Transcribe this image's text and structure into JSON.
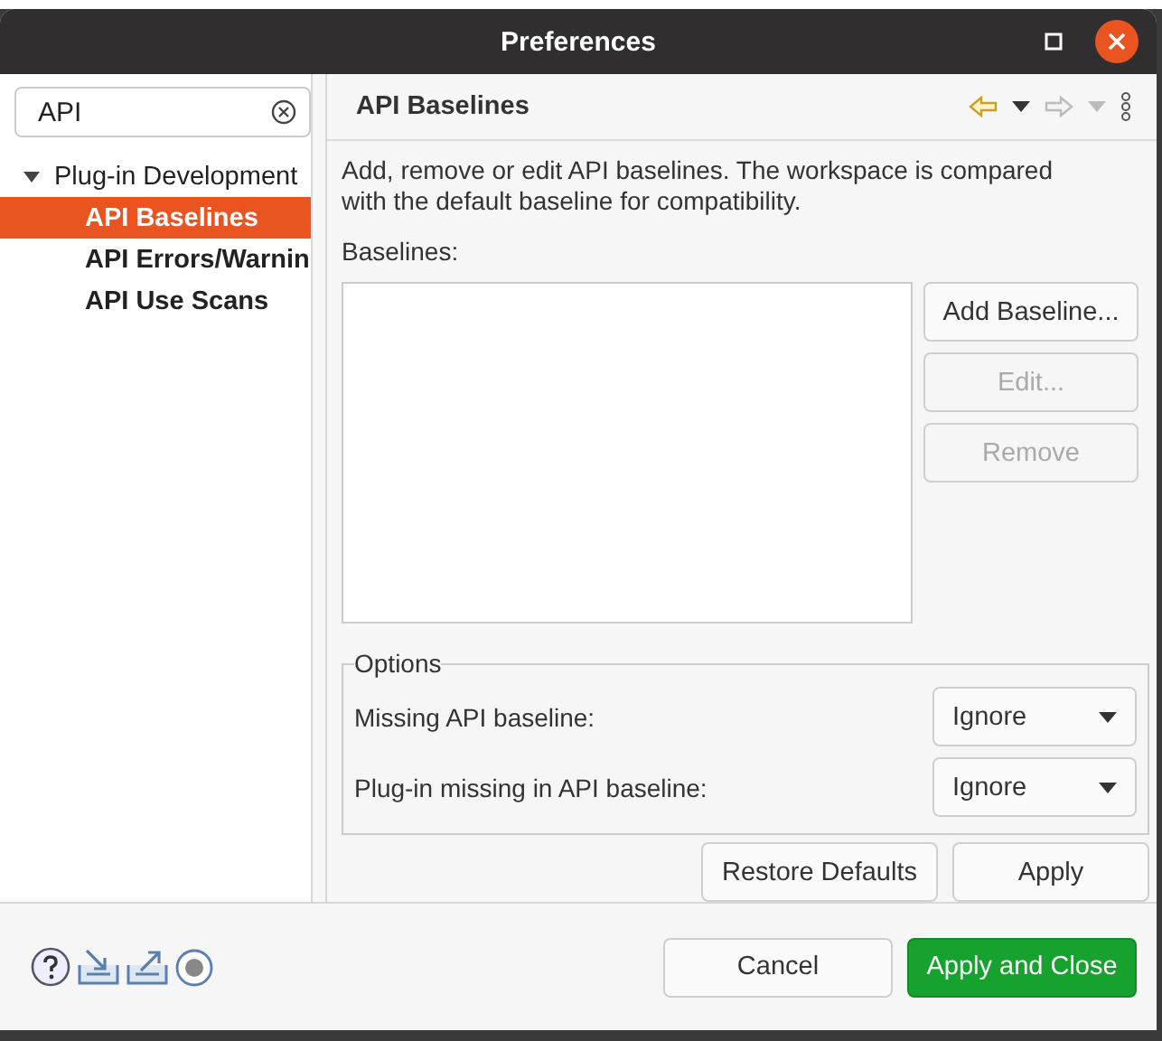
{
  "window": {
    "title": "Preferences"
  },
  "filter": {
    "value": "API"
  },
  "tree": [
    {
      "label": "Plug-in Development",
      "expanded": true,
      "selected": false,
      "children": [
        {
          "label": "API Baselines",
          "selected": true
        },
        {
          "label": "API Errors/Warnin",
          "selected": false
        },
        {
          "label": "API Use Scans",
          "selected": false
        }
      ]
    }
  ],
  "page": {
    "title": "API Baselines",
    "description": "Add, remove or edit API baselines. The workspace is compared with the default baseline for compatibility.",
    "list_label": "Baselines:",
    "list_buttons": [
      {
        "label": "Add Baseline...",
        "disabled": false
      },
      {
        "label": "Edit...",
        "disabled": true
      },
      {
        "label": "Remove",
        "disabled": true
      }
    ],
    "options": {
      "title": "Options",
      "rows": [
        {
          "label": "Missing API baseline:",
          "value": "Ignore"
        },
        {
          "label": "Plug-in missing in API baseline:",
          "value": "Ignore"
        }
      ]
    },
    "buttons": [
      "Restore Defaults",
      "Apply"
    ]
  },
  "footer": {
    "buttons": [
      {
        "label": "Cancel",
        "kind": "normal"
      },
      {
        "label": "Apply and Close",
        "kind": "primary"
      }
    ]
  }
}
